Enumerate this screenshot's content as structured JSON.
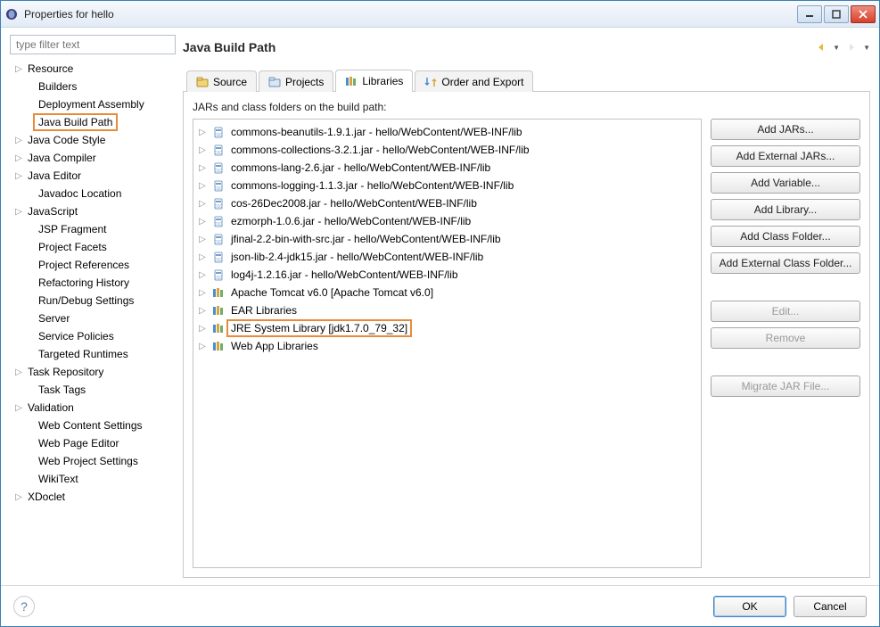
{
  "window": {
    "title": "Properties for hello"
  },
  "filter": {
    "placeholder": "type filter text"
  },
  "nav_tree": {
    "items": [
      {
        "label": "Resource",
        "expandable": true,
        "depth": 0
      },
      {
        "label": "Builders",
        "expandable": false,
        "depth": 1
      },
      {
        "label": "Deployment Assembly",
        "expandable": false,
        "depth": 1
      },
      {
        "label": "Java Build Path",
        "expandable": false,
        "depth": 1,
        "selected": true
      },
      {
        "label": "Java Code Style",
        "expandable": true,
        "depth": 0
      },
      {
        "label": "Java Compiler",
        "expandable": true,
        "depth": 0
      },
      {
        "label": "Java Editor",
        "expandable": true,
        "depth": 0
      },
      {
        "label": "Javadoc Location",
        "expandable": false,
        "depth": 1
      },
      {
        "label": "JavaScript",
        "expandable": true,
        "depth": 0
      },
      {
        "label": "JSP Fragment",
        "expandable": false,
        "depth": 1
      },
      {
        "label": "Project Facets",
        "expandable": false,
        "depth": 1
      },
      {
        "label": "Project References",
        "expandable": false,
        "depth": 1
      },
      {
        "label": "Refactoring History",
        "expandable": false,
        "depth": 1
      },
      {
        "label": "Run/Debug Settings",
        "expandable": false,
        "depth": 1
      },
      {
        "label": "Server",
        "expandable": false,
        "depth": 1
      },
      {
        "label": "Service Policies",
        "expandable": false,
        "depth": 1
      },
      {
        "label": "Targeted Runtimes",
        "expandable": false,
        "depth": 1
      },
      {
        "label": "Task Repository",
        "expandable": true,
        "depth": 0
      },
      {
        "label": "Task Tags",
        "expandable": false,
        "depth": 1
      },
      {
        "label": "Validation",
        "expandable": true,
        "depth": 0
      },
      {
        "label": "Web Content Settings",
        "expandable": false,
        "depth": 1
      },
      {
        "label": "Web Page Editor",
        "expandable": false,
        "depth": 1
      },
      {
        "label": "Web Project Settings",
        "expandable": false,
        "depth": 1
      },
      {
        "label": "WikiText",
        "expandable": false,
        "depth": 1
      },
      {
        "label": "XDoclet",
        "expandable": true,
        "depth": 0
      }
    ]
  },
  "page": {
    "title": "Java Build Path"
  },
  "tabs": [
    {
      "label": "Source",
      "icon": "source-icon"
    },
    {
      "label": "Projects",
      "icon": "projects-icon"
    },
    {
      "label": "Libraries",
      "icon": "libraries-icon",
      "active": true
    },
    {
      "label": "Order and Export",
      "icon": "order-icon"
    }
  ],
  "instruction": "JARs and class folders on the build path:",
  "libraries": [
    {
      "label": "commons-beanutils-1.9.1.jar - hello/WebContent/WEB-INF/lib",
      "type": "jar"
    },
    {
      "label": "commons-collections-3.2.1.jar - hello/WebContent/WEB-INF/lib",
      "type": "jar"
    },
    {
      "label": "commons-lang-2.6.jar - hello/WebContent/WEB-INF/lib",
      "type": "jar"
    },
    {
      "label": "commons-logging-1.1.3.jar - hello/WebContent/WEB-INF/lib",
      "type": "jar"
    },
    {
      "label": "cos-26Dec2008.jar - hello/WebContent/WEB-INF/lib",
      "type": "jar"
    },
    {
      "label": "ezmorph-1.0.6.jar - hello/WebContent/WEB-INF/lib",
      "type": "jar"
    },
    {
      "label": "jfinal-2.2-bin-with-src.jar - hello/WebContent/WEB-INF/lib",
      "type": "jar"
    },
    {
      "label": "json-lib-2.4-jdk15.jar - hello/WebContent/WEB-INF/lib",
      "type": "jar"
    },
    {
      "label": "log4j-1.2.16.jar - hello/WebContent/WEB-INF/lib",
      "type": "jar"
    },
    {
      "label": "Apache Tomcat v6.0 [Apache Tomcat v6.0]",
      "type": "lib"
    },
    {
      "label": "EAR Libraries",
      "type": "lib"
    },
    {
      "label": "JRE System Library [jdk1.7.0_79_32]",
      "type": "lib",
      "highlight": true
    },
    {
      "label": "Web App Libraries",
      "type": "lib"
    }
  ],
  "buttons": {
    "add_jars": "Add JARs...",
    "add_external_jars": "Add External JARs...",
    "add_variable": "Add Variable...",
    "add_library": "Add Library...",
    "add_class_folder": "Add Class Folder...",
    "add_external_class_folder": "Add External Class Folder...",
    "edit": "Edit...",
    "remove": "Remove",
    "migrate": "Migrate JAR File..."
  },
  "footer": {
    "ok": "OK",
    "cancel": "Cancel"
  }
}
